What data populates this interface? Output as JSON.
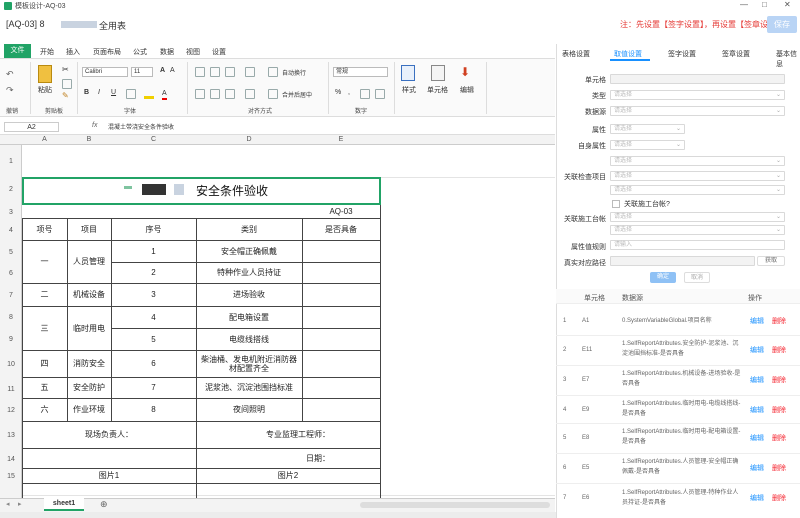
{
  "window": {
    "title": "模板设计-AQ-03",
    "minimize": "—",
    "maximize": "□",
    "close": "✕"
  },
  "doc": {
    "name": "[AQ-03] 8",
    "name_suffix": "全用表",
    "hint": "注：先设置【签字设置】，再设置【签章设置】",
    "save": "保存"
  },
  "menu": [
    "文件",
    "开始",
    "插入",
    "页面布局",
    "公式",
    "数据",
    "视图",
    "设置"
  ],
  "ribbon": {
    "paste": "粘贴",
    "clip": "剪贴板",
    "undo": "撤销",
    "font": "Calibri",
    "size": "11",
    "font_group": "字体",
    "wrap": "自动换行",
    "merge": "合并后居中",
    "align_group": "对齐方式",
    "format": "常规",
    "num_group": "数字",
    "style": "样式",
    "cell": "单元格",
    "edit": "编辑"
  },
  "formula": {
    "name": "A2",
    "fx": "fx",
    "text": "混凝土带浇安全条件验收"
  },
  "columns": [
    "A",
    "B",
    "C",
    "D",
    "E"
  ],
  "rows": [
    "1",
    "2",
    "3",
    "4",
    "5",
    "6",
    "7",
    "8",
    "9",
    "10",
    "11",
    "12",
    "13",
    "14",
    "15"
  ],
  "sheet": {
    "title_suffix": "安全条件验收",
    "code": "AQ-03",
    "headers": [
      "项号",
      "项目",
      "序号",
      "类别",
      "是否具备"
    ],
    "c1": "一",
    "c1_item": "人员管理",
    "c1_r1_no": "1",
    "c1_r1_cat": "安全帽正确佩戴",
    "c1_r2_no": "2",
    "c1_r2_cat": "特种作业人员持证",
    "c2": "二",
    "c2_item": "机械设备",
    "c2_no": "3",
    "c2_cat": "进场验收",
    "c3": "三",
    "c3_item": "临时用电",
    "c3_r1_no": "4",
    "c3_r1_cat": "配电箱设置",
    "c3_r2_no": "5",
    "c3_r2_cat": "电缆线搭线",
    "c4": "四",
    "c4_item": "消防安全",
    "c4_no": "6",
    "c4_cat": "柴油桶、发电机附近消防器材配置齐全",
    "c5": "五",
    "c5_item": "安全防护",
    "c5_no": "7",
    "c5_cat": "泥浆池、沉淀池围挡标准",
    "c6": "六",
    "c6_item": "作业环境",
    "c6_no": "8",
    "c6_cat": "夜间照明",
    "site_lead": "现场负责人：",
    "supervisor": "专业监理工程师：",
    "date": "日期：",
    "pic1": "图片1",
    "pic2": "图片2"
  },
  "sheet_tab": "sheet1",
  "panel": {
    "tabs": [
      "表格设置",
      "取值设置",
      "签字设置",
      "签章设置",
      "基本信息"
    ],
    "labels": {
      "cell": "单元格",
      "type": "类型",
      "source": "数据源",
      "attr": "属性",
      "selfattr": "自身属性",
      "linked": "关联检查项目",
      "linkproc": "关联施工台帐",
      "attrrule": "属性值规则",
      "path": "真实对应路径"
    },
    "placeholder": "请选择",
    "input_placeholder": "请输入",
    "checkbox": "关联施工台帐?",
    "fetch": "获取",
    "confirm": "确定",
    "cancel": "取消",
    "table_headers": [
      "单元格",
      "数据源",
      "操作"
    ],
    "edit": "编辑",
    "delete": "删除",
    "rows": [
      {
        "no": "1",
        "cell": "A1",
        "src": "0.SystemVariableGlobal.项目名称"
      },
      {
        "no": "2",
        "cell": "E11",
        "src": "1.SelfReportAttributes.安全防护-泥浆池、沉淀池围挡标准-是否具备"
      },
      {
        "no": "3",
        "cell": "E7",
        "src": "1.SelfReportAttributes.机械设备-进场验收-是否具备"
      },
      {
        "no": "4",
        "cell": "E9",
        "src": "1.SelfReportAttributes.临时用电-电缆线搭线-是否具备"
      },
      {
        "no": "5",
        "cell": "E8",
        "src": "1.SelfReportAttributes.临时用电-配电箱设置-是否具备"
      },
      {
        "no": "6",
        "cell": "E5",
        "src": "1.SelfReportAttributes.人员管理-安全帽正确佩戴-是否具备"
      },
      {
        "no": "7",
        "cell": "E6",
        "src": "1.SelfReportAttributes.人员管理-特种作业人员持证-是否具备"
      }
    ]
  },
  "colors": {
    "accent": "#21a366",
    "link": "#1890ff",
    "danger": "#f5222d",
    "hint": "#e53935"
  }
}
